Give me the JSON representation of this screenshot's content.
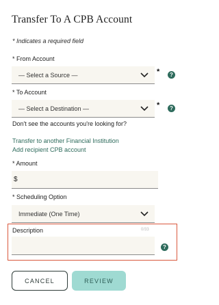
{
  "page": {
    "title": "Transfer To A CPB Account",
    "required_note": "* Indicates a required field"
  },
  "from_account": {
    "label": "* From Account",
    "value": "— Select a Source —",
    "required_mark": "*"
  },
  "to_account": {
    "label": "* To Account",
    "value": "— Select a Destination —",
    "required_mark": "*"
  },
  "missing_accounts": {
    "prompt": "Don't see the accounts you're looking for?",
    "link_transfer_other": "Transfer to another Financial Institution",
    "link_add_recipient": "Add recipient CPB account"
  },
  "amount": {
    "label": "* Amount",
    "currency_symbol": "$",
    "value": ""
  },
  "scheduling": {
    "label": "* Scheduling Option",
    "value": "Immediate (One Time)"
  },
  "description": {
    "label": "Description",
    "counter": "0/33",
    "value": ""
  },
  "help_icon_glyph": "?",
  "buttons": {
    "cancel": "CANCEL",
    "review": "REVIEW"
  },
  "colors": {
    "accent": "#2e6b5c",
    "review_button_bg": "#9fdad2",
    "highlight_border": "#d9573c",
    "field_bg": "#f8f6f0"
  }
}
